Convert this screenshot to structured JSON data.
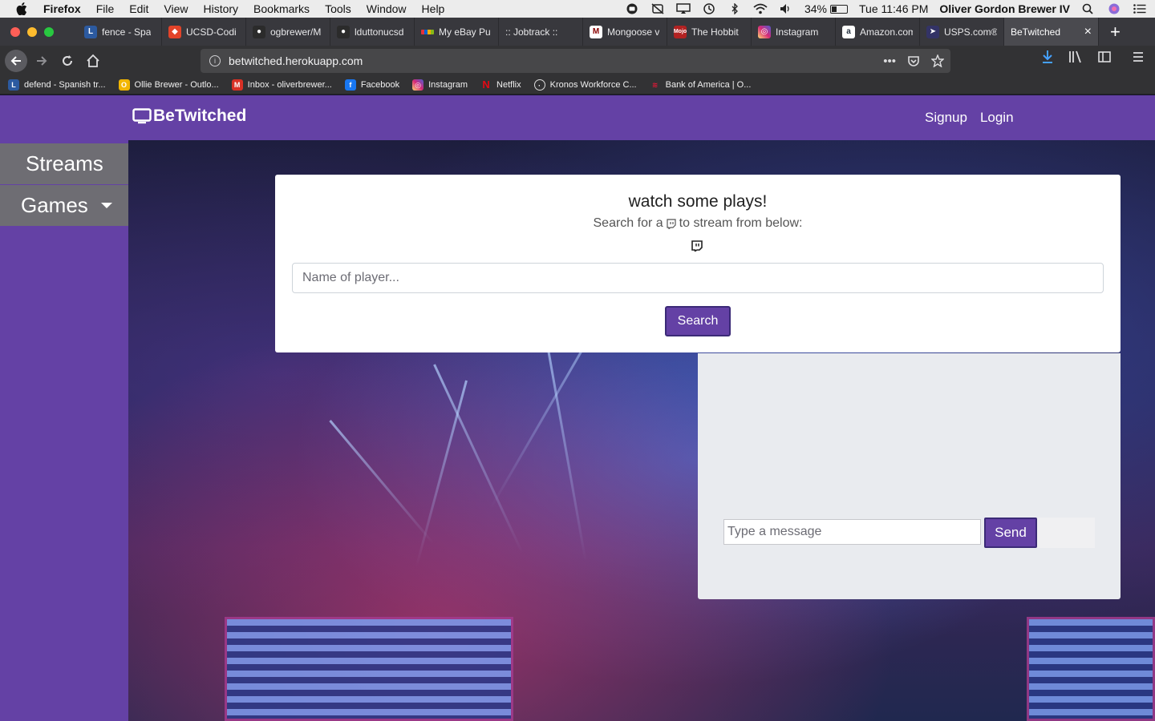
{
  "menubar": {
    "app_name": "Firefox",
    "items": [
      "File",
      "Edit",
      "View",
      "History",
      "Bookmarks",
      "Tools",
      "Window",
      "Help"
    ],
    "battery": "34%",
    "clock": "Tue 11:46 PM",
    "user": "Oliver Gordon Brewer IV"
  },
  "tabs": [
    {
      "label": "fence - Spa",
      "icon": "spanishdict-icon",
      "color": "#2c5aa0"
    },
    {
      "label": "UCSD-Codi",
      "icon": "gitlab-icon",
      "color": "#e24329"
    },
    {
      "label": "ogbrewer/M",
      "icon": "github-icon",
      "color": "#333333"
    },
    {
      "label": "lduttonucsd",
      "icon": "github-icon",
      "color": "#333333"
    },
    {
      "label": "My eBay Pu",
      "icon": "ebay-icon",
      "color": "#e53238"
    },
    {
      "label": ":: Jobtrack ::",
      "icon": "blank-icon",
      "color": "#38383d"
    },
    {
      "label": "Mongoose v",
      "icon": "mongoose-icon",
      "color": "#880000"
    },
    {
      "label": "The Hobbit",
      "icon": "mojo-icon",
      "color": "#b22222"
    },
    {
      "label": "Instagram",
      "icon": "instagram-icon",
      "color": "#d62976"
    },
    {
      "label": "Amazon.com",
      "icon": "amazon-icon",
      "color": "#232f3e"
    },
    {
      "label": "USPS.com®",
      "icon": "usps-icon",
      "color": "#333366"
    }
  ],
  "active_tab": {
    "label": "BeTwitched",
    "close": "×"
  },
  "url": "betwitched.herokuapp.com",
  "bookmarks": [
    {
      "label": "defend - Spanish tr...",
      "icon": "spanishdict-icon",
      "color": "#2c5aa0"
    },
    {
      "label": "Ollie Brewer - Outlo...",
      "icon": "outlook-icon",
      "color": "#f2b600"
    },
    {
      "label": "Inbox - oliverbrewer...",
      "icon": "gmail-icon",
      "color": "#d93025"
    },
    {
      "label": "Facebook",
      "icon": "facebook-icon",
      "color": "#1877f2"
    },
    {
      "label": "Instagram",
      "icon": "instagram-icon",
      "color": "#d62976"
    },
    {
      "label": "Netflix",
      "icon": "netflix-icon",
      "color": "#e50914"
    },
    {
      "label": "Kronos Workforce C...",
      "icon": "globe-icon",
      "color": "#323234"
    },
    {
      "label": "Bank of America | O...",
      "icon": "bofa-icon",
      "color": "#e31837"
    }
  ],
  "app": {
    "brand": "BeTwitched",
    "nav": {
      "signup": "Signup",
      "login": "Login"
    },
    "sidebar": {
      "streams": "Streams",
      "games": "Games"
    },
    "search_card": {
      "title": "watch some plays!",
      "subtitle_before": "Search for a",
      "subtitle_after": "to stream from below:",
      "input_placeholder": "Name of player...",
      "button": "Search"
    },
    "chat": {
      "input_placeholder": "Type a message",
      "button": "Send"
    }
  },
  "colors": {
    "twitch_purple": "#6441a5",
    "sidebar_item": "#6e6d73",
    "chat_panel": "#e9ebef"
  }
}
